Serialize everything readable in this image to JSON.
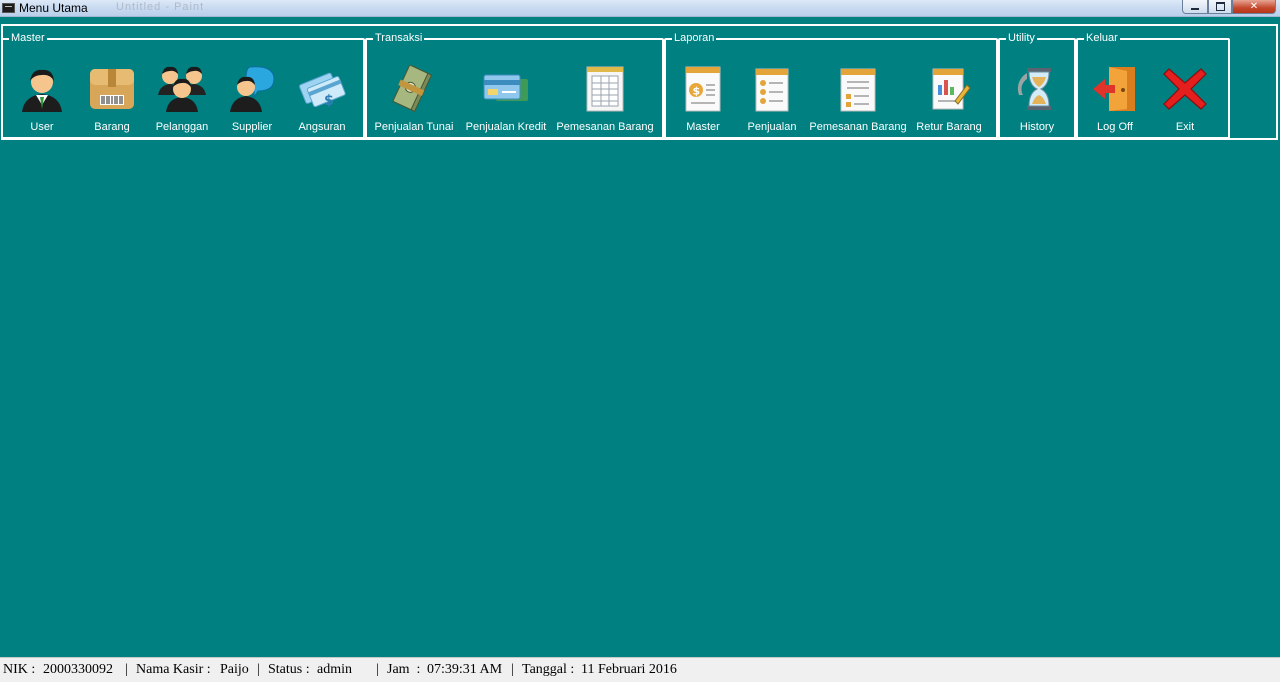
{
  "window": {
    "title": "Menu Utama",
    "ghost_text": "Untitled - Paint",
    "min_icon": "minimize-icon",
    "max_icon": "maximize-icon",
    "close_icon": "close-icon",
    "close_glyph": "✕"
  },
  "ribbon": {
    "groups": [
      {
        "label": "Master",
        "items": [
          {
            "label": "User",
            "icon": "user-icon"
          },
          {
            "label": "Barang",
            "icon": "box-icon"
          },
          {
            "label": "Pelanggan",
            "icon": "group-users-icon"
          },
          {
            "label": "Supplier",
            "icon": "supplier-chat-icon"
          },
          {
            "label": "Angsuran",
            "icon": "credit-cards-icon"
          }
        ]
      },
      {
        "label": "Transaksi",
        "items": [
          {
            "label": "Penjualan Tunai",
            "icon": "cash-icon"
          },
          {
            "label": "Penjualan Kredit",
            "icon": "credit-card-icon"
          },
          {
            "label": "Pemesanan Barang",
            "icon": "order-sheet-icon"
          }
        ]
      },
      {
        "label": "Laporan",
        "items": [
          {
            "label": "Master",
            "icon": "report-dollar-icon"
          },
          {
            "label": "Penjualan",
            "icon": "report-list-icon"
          },
          {
            "label": "Pemesanan Barang",
            "icon": "report-order-icon"
          },
          {
            "label": "Retur Barang",
            "icon": "report-chart-icon"
          }
        ]
      },
      {
        "label": "Utility",
        "items": [
          {
            "label": "History",
            "icon": "hourglass-icon"
          }
        ]
      },
      {
        "label": "Keluar",
        "items": [
          {
            "label": "Log Off",
            "icon": "log-off-door-icon"
          },
          {
            "label": "Exit",
            "icon": "exit-x-icon"
          }
        ]
      }
    ]
  },
  "status": {
    "nik_label": "NIK :",
    "nik": "2000330092",
    "sep": "|",
    "kasir_label": "Nama Kasir :",
    "kasir": "Paijo",
    "status_label": "Status :",
    "status": "admin",
    "jam_label": "Jam  :",
    "jam": "07:39:31 AM",
    "tanggal_label": "Tanggal :",
    "tanggal": "11 Februari 2016"
  },
  "colors": {
    "background": "#008080",
    "statusbar": "#f0f0f0"
  }
}
